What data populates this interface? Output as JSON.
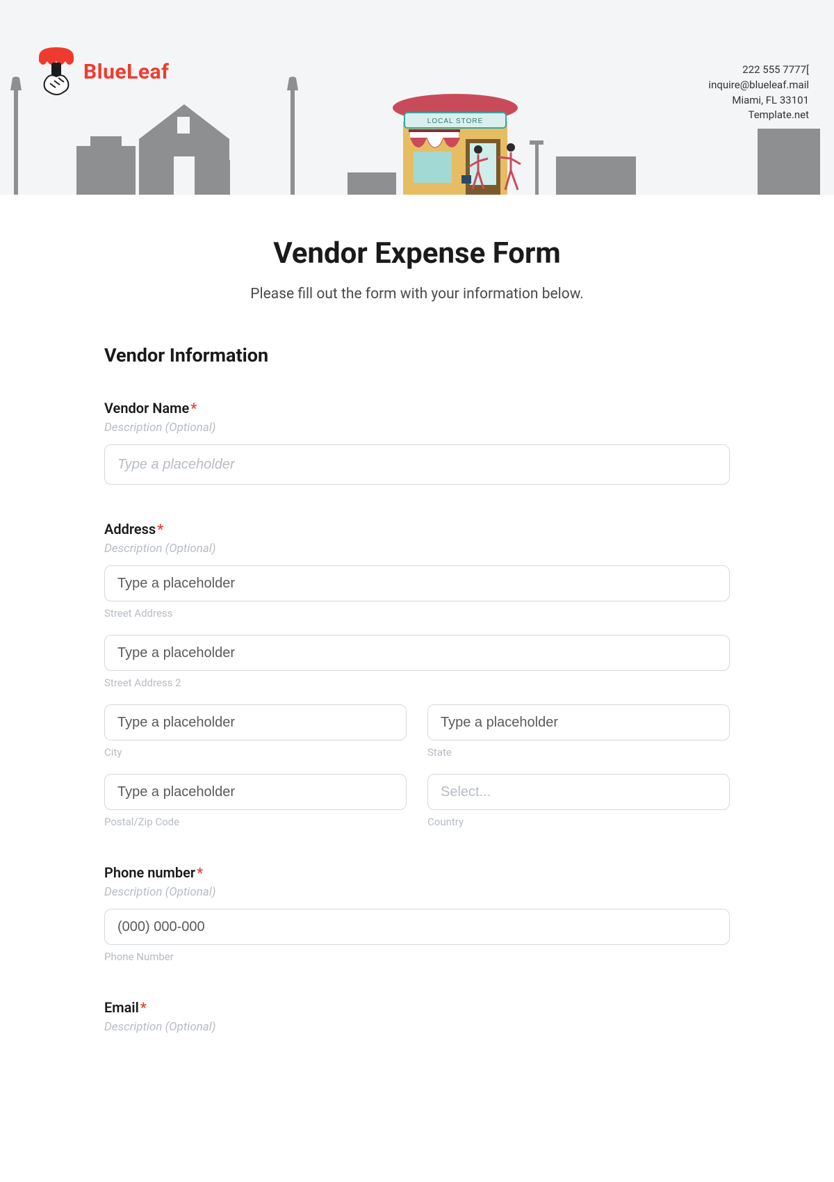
{
  "brand": {
    "name": "BlueLeaf"
  },
  "contact": {
    "phone": "222 555 7777[",
    "email": "inquire@blueleaf.mail",
    "cityline": "Miami, FL 33101",
    "site": "Template.net"
  },
  "store_sign": "LOCAL STORE",
  "title": "Vendor Expense Form",
  "subtitle": "Please fill out the form with your information below.",
  "section_vendor": "Vendor Information",
  "desc_optional": "Description (Optional)",
  "ph_generic": "Type a placeholder",
  "vendor_name": {
    "label": "Vendor Name"
  },
  "address": {
    "label": "Address",
    "street": "Street Address",
    "street2": "Street Address 2",
    "city": "City",
    "state": "State",
    "postal": "Postal/Zip Code",
    "country": "Country",
    "select_ph": "Select..."
  },
  "phone": {
    "label": "Phone number",
    "sub": "Phone Number",
    "ph": "(000) 000-000"
  },
  "emailf": {
    "label": "Email"
  }
}
